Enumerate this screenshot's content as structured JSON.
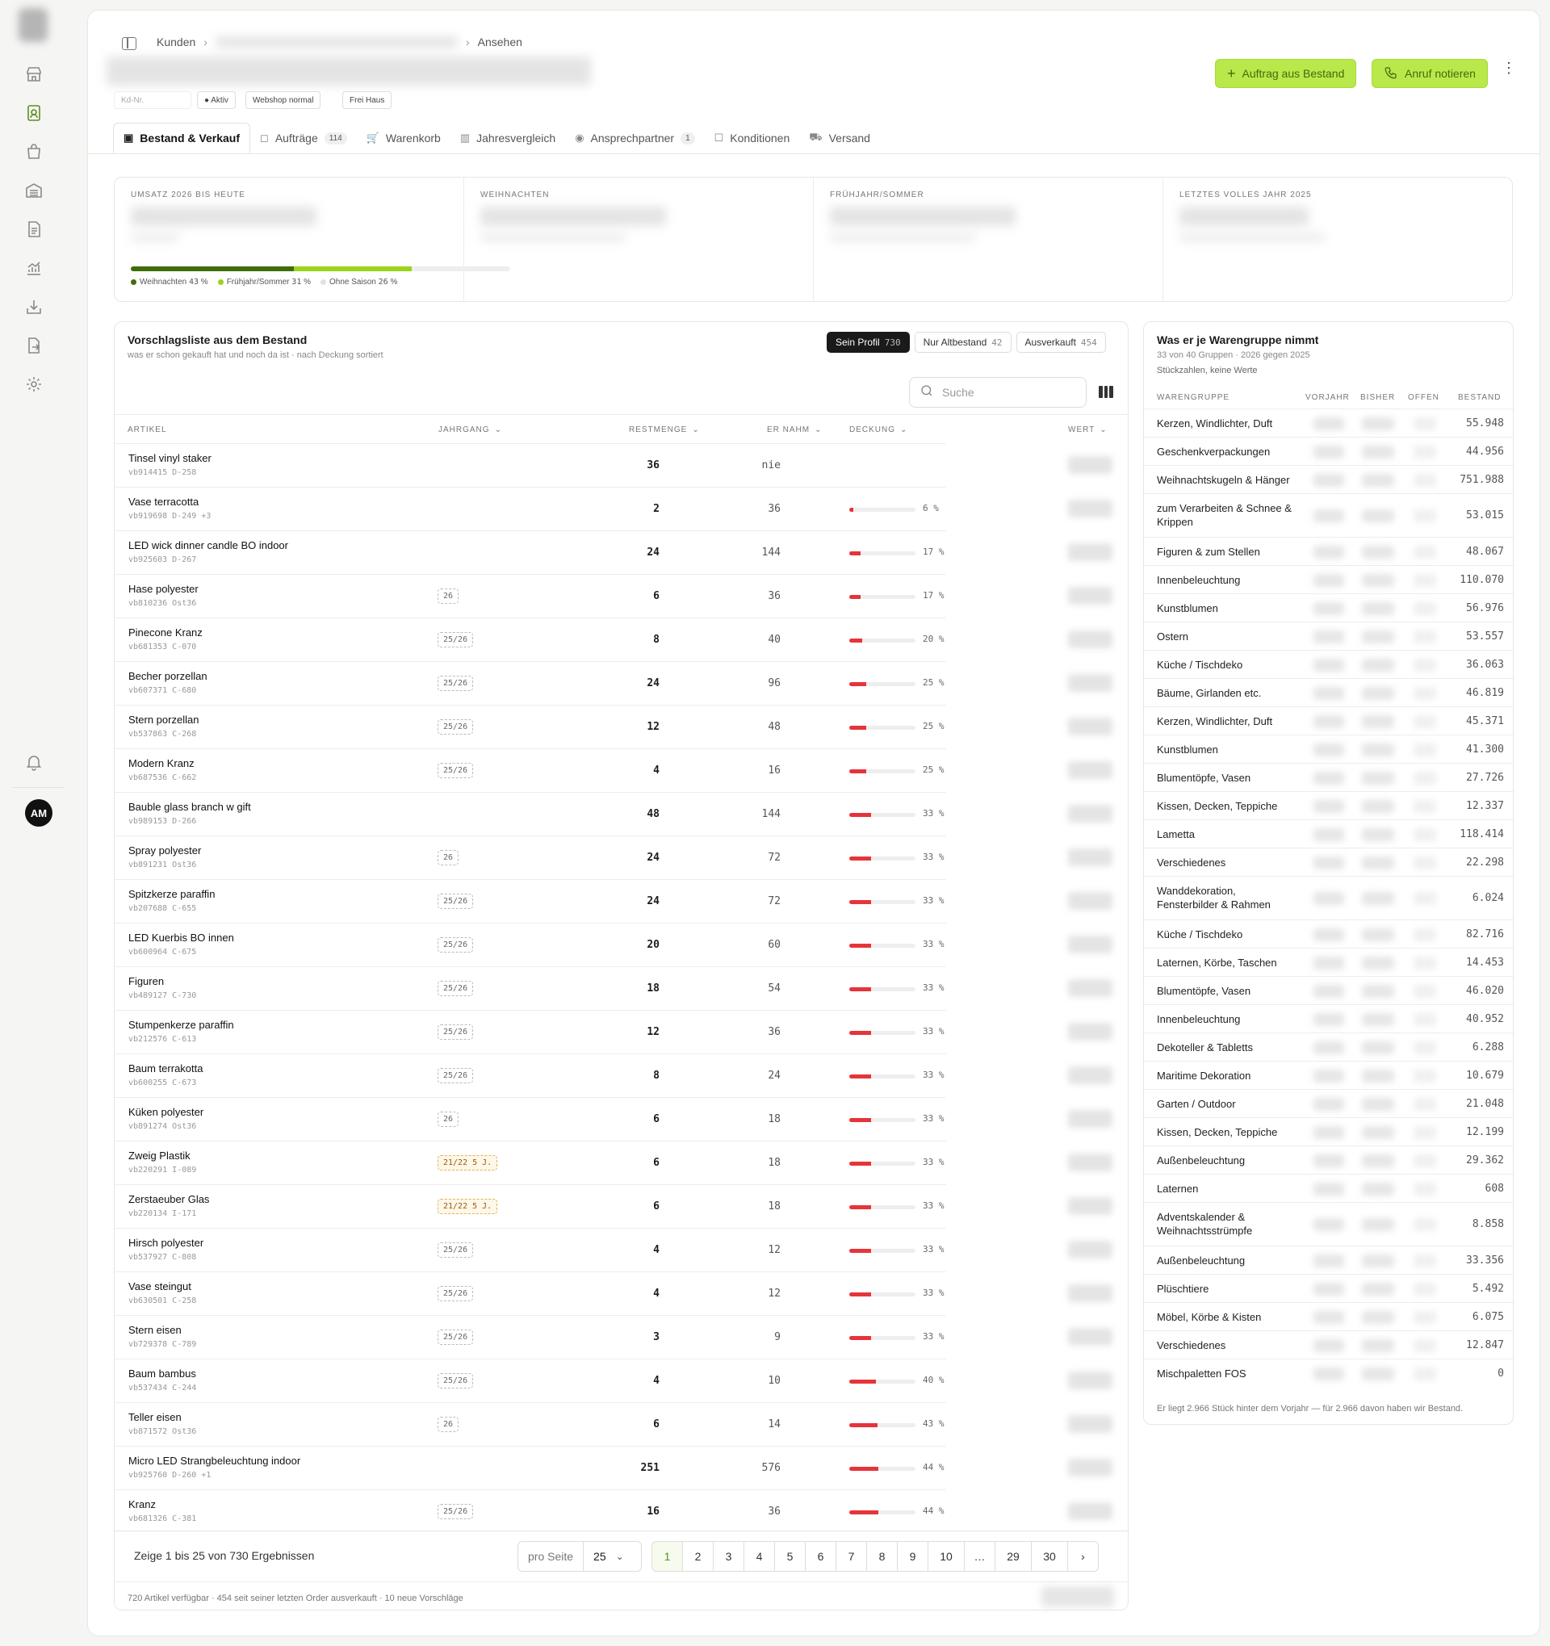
{
  "nav": {
    "icons": [
      "store-icon",
      "customer-icon",
      "bag-icon",
      "warehouse-icon",
      "document-icon",
      "chart-icon",
      "download-icon",
      "file-export-icon",
      "gear-icon"
    ],
    "bell": "bell-icon",
    "avatar": "AM"
  },
  "breadcrumb": {
    "first": "Kunden",
    "last": "Ansehen"
  },
  "chips": {
    "kd": "Kd-Nr.",
    "status": "● Aktiv",
    "webshop": "Webshop normal",
    "versand": "Frei Haus"
  },
  "actions": {
    "auftrag": "Auftrag aus Bestand",
    "anruf": "Anruf notieren"
  },
  "tabs": [
    {
      "label": "Bestand & Verkauf"
    },
    {
      "label": "Aufträge",
      "count": "114"
    },
    {
      "label": "Warenkorb"
    },
    {
      "label": "Jahresvergleich"
    },
    {
      "label": "Ansprechpartner",
      "count": "1"
    },
    {
      "label": "Konditionen"
    },
    {
      "label": "Versand"
    }
  ],
  "kpis": [
    {
      "label": "UMSATZ 2026 BIS HEUTE"
    },
    {
      "label": "WEIHNACHTEN"
    },
    {
      "label": "FRÜHJAHR/SOMMER"
    },
    {
      "label": "LETZTES VOLLES JAHR 2025"
    }
  ],
  "season_split": {
    "weihnachten": {
      "label": "Weihnachten",
      "pct": 43,
      "color": "#3f6d0a"
    },
    "fruehjahr": {
      "label": "Frühjahr/Sommer",
      "pct": 31,
      "color": "#9ad41a"
    },
    "ohne": {
      "label": "Ohne Saison",
      "pct": 26,
      "color": "#e2e2e2"
    }
  },
  "list": {
    "title": "Vorschlagsliste aus dem Bestand",
    "subtitle": "was er schon gekauft hat und noch da ist · nach Deckung sortiert",
    "filters": [
      {
        "label": "Sein Profil",
        "count": "730",
        "active": true
      },
      {
        "label": "Nur Altbestand",
        "count": "42"
      },
      {
        "label": "Ausverkauft",
        "count": "454"
      }
    ],
    "search_placeholder": "Suche",
    "columns": {
      "artikel": "ARTIKEL",
      "jahrgang": "JAHRGANG",
      "restmenge": "RESTMENGE",
      "ernahm": "ER NAHM",
      "deckung": "DECKUNG",
      "wert": "WERT"
    },
    "rows": [
      {
        "name": "Tinsel vinyl staker",
        "sku": "vb914415  D-258",
        "jg": "",
        "rest": "36",
        "nahm": "nie",
        "pct": null
      },
      {
        "name": "Vase terracotta",
        "sku": "vb919698  D-249  +3",
        "jg": "",
        "rest": "2",
        "nahm": "36",
        "pct": 6
      },
      {
        "name": "LED wick dinner candle BO indoor",
        "sku": "vb925603  D-267",
        "jg": "",
        "rest": "24",
        "nahm": "144",
        "pct": 17
      },
      {
        "name": "Hase polyester",
        "sku": "vb810236  Ost36",
        "jg": "26",
        "rest": "6",
        "nahm": "36",
        "pct": 17
      },
      {
        "name": "Pinecone Kranz",
        "sku": "vb681353  C-070",
        "jg": "25/26",
        "rest": "8",
        "nahm": "40",
        "pct": 20
      },
      {
        "name": "Becher porzellan",
        "sku": "vb607371  C-680",
        "jg": "25/26",
        "rest": "24",
        "nahm": "96",
        "pct": 25
      },
      {
        "name": "Stern porzellan",
        "sku": "vb537863  C-268",
        "jg": "25/26",
        "rest": "12",
        "nahm": "48",
        "pct": 25
      },
      {
        "name": "Modern Kranz",
        "sku": "vb687536  C-662",
        "jg": "25/26",
        "rest": "4",
        "nahm": "16",
        "pct": 25
      },
      {
        "name": "Bauble glass branch w gift",
        "sku": "vb989153  D-266",
        "jg": "",
        "rest": "48",
        "nahm": "144",
        "pct": 33
      },
      {
        "name": "Spray polyester",
        "sku": "vb891231  Ost36",
        "jg": "26",
        "rest": "24",
        "nahm": "72",
        "pct": 33
      },
      {
        "name": "Spitzkerze paraffin",
        "sku": "vb207688  C-655",
        "jg": "25/26",
        "rest": "24",
        "nahm": "72",
        "pct": 33
      },
      {
        "name": "LED Kuerbis BO innen",
        "sku": "vb600964  C-675",
        "jg": "25/26",
        "rest": "20",
        "nahm": "60",
        "pct": 33
      },
      {
        "name": "Figuren",
        "sku": "vb489127  C-730",
        "jg": "25/26",
        "rest": "18",
        "nahm": "54",
        "pct": 33
      },
      {
        "name": "Stumpenkerze paraffin",
        "sku": "vb212576  C-613",
        "jg": "25/26",
        "rest": "12",
        "nahm": "36",
        "pct": 33
      },
      {
        "name": "Baum terrakotta",
        "sku": "vb600255  C-673",
        "jg": "25/26",
        "rest": "8",
        "nahm": "24",
        "pct": 33
      },
      {
        "name": "Küken polyester",
        "sku": "vb891274  Ost36",
        "jg": "26",
        "rest": "6",
        "nahm": "18",
        "pct": 33
      },
      {
        "name": "Zweig Plastik",
        "sku": "vb220291  I-089",
        "jg": "21/22 5 J.",
        "warn": true,
        "rest": "6",
        "nahm": "18",
        "pct": 33
      },
      {
        "name": "Zerstaeuber Glas",
        "sku": "vb220134  I-171",
        "jg": "21/22 5 J.",
        "warn": true,
        "rest": "6",
        "nahm": "18",
        "pct": 33
      },
      {
        "name": "Hirsch polyester",
        "sku": "vb537927  C-808",
        "jg": "25/26",
        "rest": "4",
        "nahm": "12",
        "pct": 33
      },
      {
        "name": "Vase steingut",
        "sku": "vb630501  C-258",
        "jg": "25/26",
        "rest": "4",
        "nahm": "12",
        "pct": 33
      },
      {
        "name": "Stern eisen",
        "sku": "vb729378  C-789",
        "jg": "25/26",
        "rest": "3",
        "nahm": "9",
        "pct": 33
      },
      {
        "name": "Baum bambus",
        "sku": "vb537434  C-244",
        "jg": "25/26",
        "rest": "4",
        "nahm": "10",
        "pct": 40
      },
      {
        "name": "Teller eisen",
        "sku": "vb871572  Ost36",
        "jg": "26",
        "rest": "6",
        "nahm": "14",
        "pct": 43
      },
      {
        "name": "Micro LED Strangbeleuchtung indoor",
        "sku": "vb925760  D-260  +1",
        "jg": "",
        "rest": "251",
        "nahm": "576",
        "pct": 44
      },
      {
        "name": "Kranz",
        "sku": "vb681326  C-381",
        "jg": "25/26",
        "rest": "16",
        "nahm": "36",
        "pct": 44
      }
    ],
    "result_text": "Zeige 1 bis 25 von 730 Ergebnissen",
    "per_page_label": "pro Seite",
    "per_page_value": "25",
    "pages": [
      "1",
      "2",
      "3",
      "4",
      "5",
      "6",
      "7",
      "8",
      "9",
      "10",
      "…",
      "29",
      "30"
    ],
    "footer": "720 Artikel verfügbar · 454 seit seiner letzten Order ausverkauft · 10 neue Vorschläge"
  },
  "groups": {
    "title": "Was er je Warengruppe nimmt",
    "subtitle1": "33 von 40 Gruppen · 2026 gegen 2025",
    "subtitle2": "Stückzahlen, keine Werte",
    "columns": {
      "gruppe": "WARENGRUPPE",
      "vorjahr": "VORJAHR",
      "bisher": "BISHER",
      "offen": "OFFEN",
      "bestand": "BESTAND"
    },
    "rows": [
      {
        "name": "Kerzen, Windlichter, Duft",
        "bestand": "55.948"
      },
      {
        "name": "Geschenkverpackungen",
        "bestand": "44.956"
      },
      {
        "name": "Weihnachtskugeln & Hänger",
        "bestand": "751.988"
      },
      {
        "name": "zum Verarbeiten & Schnee & Krippen",
        "bestand": "53.015"
      },
      {
        "name": "Figuren & zum Stellen",
        "bestand": "48.067"
      },
      {
        "name": "Innenbeleuchtung",
        "bestand": "110.070"
      },
      {
        "name": "Kunstblumen",
        "bestand": "56.976"
      },
      {
        "name": "Ostern",
        "bestand": "53.557"
      },
      {
        "name": "Küche / Tischdeko",
        "bestand": "36.063"
      },
      {
        "name": "Bäume, Girlanden etc.",
        "bestand": "46.819"
      },
      {
        "name": "Kerzen, Windlichter, Duft",
        "bestand": "45.371"
      },
      {
        "name": "Kunstblumen",
        "bestand": "41.300"
      },
      {
        "name": "Blumentöpfe, Vasen",
        "bestand": "27.726"
      },
      {
        "name": "Kissen, Decken, Teppiche",
        "bestand": "12.337"
      },
      {
        "name": "Lametta",
        "bestand": "118.414"
      },
      {
        "name": "Verschiedenes",
        "bestand": "22.298"
      },
      {
        "name": "Wanddekoration, Fensterbilder & Rahmen",
        "bestand": "6.024"
      },
      {
        "name": "Küche / Tischdeko",
        "bestand": "82.716"
      },
      {
        "name": "Laternen, Körbe, Taschen",
        "bestand": "14.453"
      },
      {
        "name": "Blumentöpfe, Vasen",
        "bestand": "46.020"
      },
      {
        "name": "Innenbeleuchtung",
        "bestand": "40.952"
      },
      {
        "name": "Dekoteller & Tabletts",
        "bestand": "6.288"
      },
      {
        "name": "Maritime Dekoration",
        "bestand": "10.679"
      },
      {
        "name": "Garten / Outdoor",
        "bestand": "21.048"
      },
      {
        "name": "Kissen, Decken, Teppiche",
        "bestand": "12.199"
      },
      {
        "name": "Außenbeleuchtung",
        "bestand": "29.362"
      },
      {
        "name": "Laternen",
        "bestand": "608"
      },
      {
        "name": "Adventskalender & Weihnachtsstrümpfe",
        "bestand": "8.858"
      },
      {
        "name": "Außenbeleuchtung",
        "bestand": "33.356"
      },
      {
        "name": "Plüschtiere",
        "bestand": "5.492"
      },
      {
        "name": "Möbel, Körbe & Kisten",
        "bestand": "6.075"
      },
      {
        "name": "Verschiedenes",
        "bestand": "12.847"
      },
      {
        "name": "Mischpaletten FOS",
        "bestand": "0"
      }
    ],
    "footer": "Er liegt 2.966 Stück hinter dem Vorjahr — für 2.966 davon haben wir Bestand."
  }
}
